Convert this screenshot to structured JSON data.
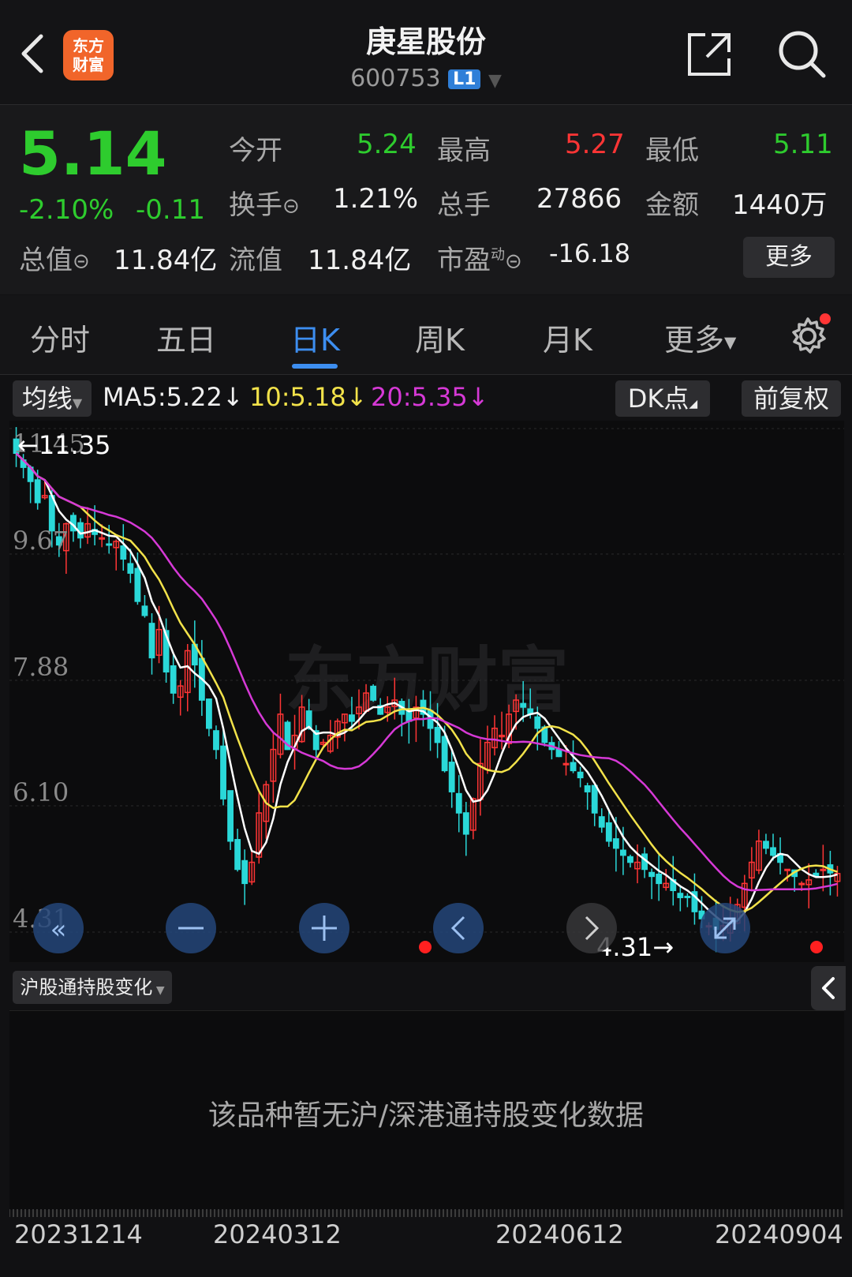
{
  "header": {
    "title": "庚星股份",
    "code": "600753",
    "level_badge": "L1",
    "logo_text_1": "东方",
    "logo_text_2": "财富"
  },
  "quote": {
    "price": "5.14",
    "change_pct": "-2.10%",
    "change": "-0.11",
    "open_label": "今开",
    "open": "5.24",
    "high_label": "最高",
    "high": "5.27",
    "low_label": "最低",
    "low": "5.11",
    "turnover_label": "换手",
    "turnover": "1.21%",
    "volume_label": "总手",
    "volume": "27866",
    "amount_label": "金额",
    "amount": "1440万",
    "total_value_label": "总值",
    "total_value": "11.84亿",
    "float_value_label": "流值",
    "float_value": "11.84亿",
    "pe_label": "市盈",
    "pe_sup": "动",
    "pe": "-16.18",
    "more_button": "更多"
  },
  "tabs": [
    "分时",
    "五日",
    "日K",
    "周K",
    "月K",
    "更多"
  ],
  "active_tab": "日K",
  "indicator_bar": {
    "ma_select": "均线",
    "ma5": "MA5:5.22↓",
    "ma10": "10:5.18↓",
    "ma20": "20:5.35↓",
    "dk_button": "DK点",
    "adjust_button": "前复权"
  },
  "chart_data": {
    "type": "candlestick",
    "y_axis_ticks": [
      "11.45",
      "9.67",
      "7.88",
      "6.10",
      "4.31"
    ],
    "ylim": [
      4.31,
      11.45
    ],
    "max_marker": "←11.35",
    "min_marker": "4.31→",
    "x_dates": [
      "20231214",
      "20240312",
      "20240612",
      "20240904"
    ],
    "close_series": [
      11.1,
      10.9,
      10.7,
      10.4,
      10.5,
      10.0,
      9.8,
      10.1,
      10.0,
      9.9,
      10.1,
      9.95,
      9.9,
      9.8,
      9.85,
      9.6,
      9.4,
      9.0,
      8.8,
      8.2,
      8.6,
      8.0,
      7.7,
      7.8,
      8.3,
      8.1,
      7.6,
      7.2,
      6.9,
      6.2,
      5.6,
      5.2,
      5.0,
      5.3,
      6.0,
      6.4,
      6.9,
      7.4,
      6.9,
      7.1,
      7.5,
      7.2,
      6.9,
      7.0,
      7.1,
      7.3,
      7.4,
      7.3,
      7.5,
      7.7,
      7.6,
      7.4,
      7.5,
      7.6,
      7.4,
      7.3,
      7.5,
      7.4,
      7.2,
      7.0,
      6.6,
      6.3,
      6.0,
      5.7,
      6.2,
      6.7,
      7.0,
      7.2,
      7.1,
      7.4,
      7.6,
      7.5,
      7.4,
      7.2,
      7.0,
      6.9,
      6.8,
      6.7,
      6.6,
      6.5,
      6.3,
      6.0,
      5.8,
      5.6,
      5.5,
      5.4,
      5.3,
      5.3,
      5.2,
      5.1,
      5.0,
      5.0,
      4.9,
      4.8,
      4.8,
      4.6,
      4.5,
      4.4,
      4.35,
      4.4,
      4.5,
      4.7,
      5.0,
      5.3,
      5.6,
      5.5,
      5.4,
      5.3,
      5.2,
      5.1,
      5.0,
      5.05,
      5.1,
      5.2,
      5.15,
      5.14
    ],
    "ma_lines": [
      {
        "name": "MA5",
        "color": "#ffffff"
      },
      {
        "name": "10",
        "color": "#f2e24a"
      },
      {
        "name": "20",
        "color": "#d639d6"
      }
    ],
    "watermark": "东方财富"
  },
  "sub_panel": {
    "select": "沪股通持股变化",
    "empty_message": "该品种暂无沪/深港通持股变化数据"
  },
  "colors": {
    "up": "#ff3535",
    "down": "#2ecc2e",
    "accent": "#3d8ef0",
    "candle_down": "#2ad8d8"
  }
}
